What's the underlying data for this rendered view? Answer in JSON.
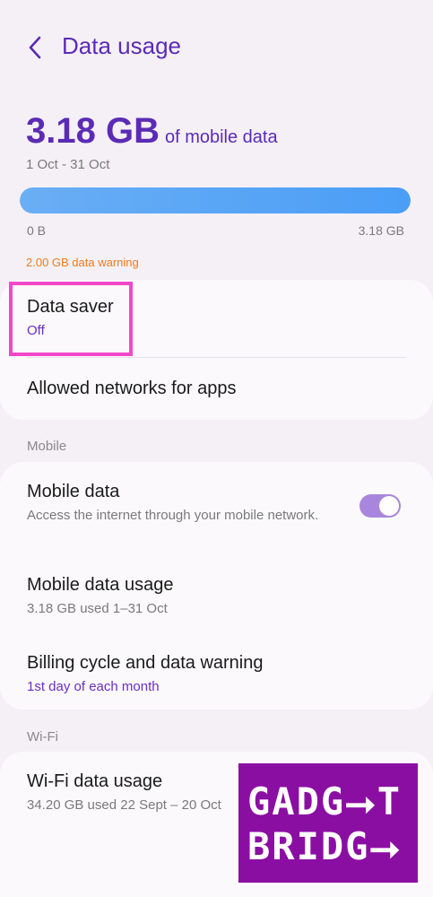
{
  "header": {
    "title": "Data usage",
    "back_icon": "chevron-left-icon"
  },
  "usage": {
    "amount": "3.18 GB",
    "of_label": "of mobile data",
    "period": "1 Oct - 31 Oct",
    "bar_min_label": "0 B",
    "bar_max_label": "3.18 GB",
    "bar_fill_fraction": 1.0,
    "warning": "2.00 GB data warning"
  },
  "card1": {
    "data_saver": {
      "title": "Data saver",
      "status": "Off"
    },
    "allowed_networks": {
      "title": "Allowed networks for apps"
    }
  },
  "sections": {
    "mobile": "Mobile",
    "wifi": "Wi-Fi"
  },
  "card2": {
    "mobile_data": {
      "title": "Mobile data",
      "description": "Access the internet through your mobile network.",
      "enabled": true
    },
    "mobile_data_usage": {
      "title": "Mobile data usage",
      "sub": "3.18 GB used 1–31 Oct"
    },
    "billing": {
      "title": "Billing cycle and data warning",
      "sub": "1st day of each month"
    }
  },
  "card3": {
    "wifi_usage": {
      "title": "Wi-Fi data usage",
      "sub": "34.20 GB used 22 Sept – 20 Oct"
    }
  },
  "watermark": {
    "line1": "GADG⭢T",
    "line2": "BRIDG⭢"
  },
  "colors": {
    "accent": "#5b2bb5",
    "bar": "#4a9ef6",
    "warning": "#f07a1c",
    "toggle_on": "#a986dd",
    "highlight": "#f248c8",
    "watermark_bg": "#8b0ea3"
  }
}
